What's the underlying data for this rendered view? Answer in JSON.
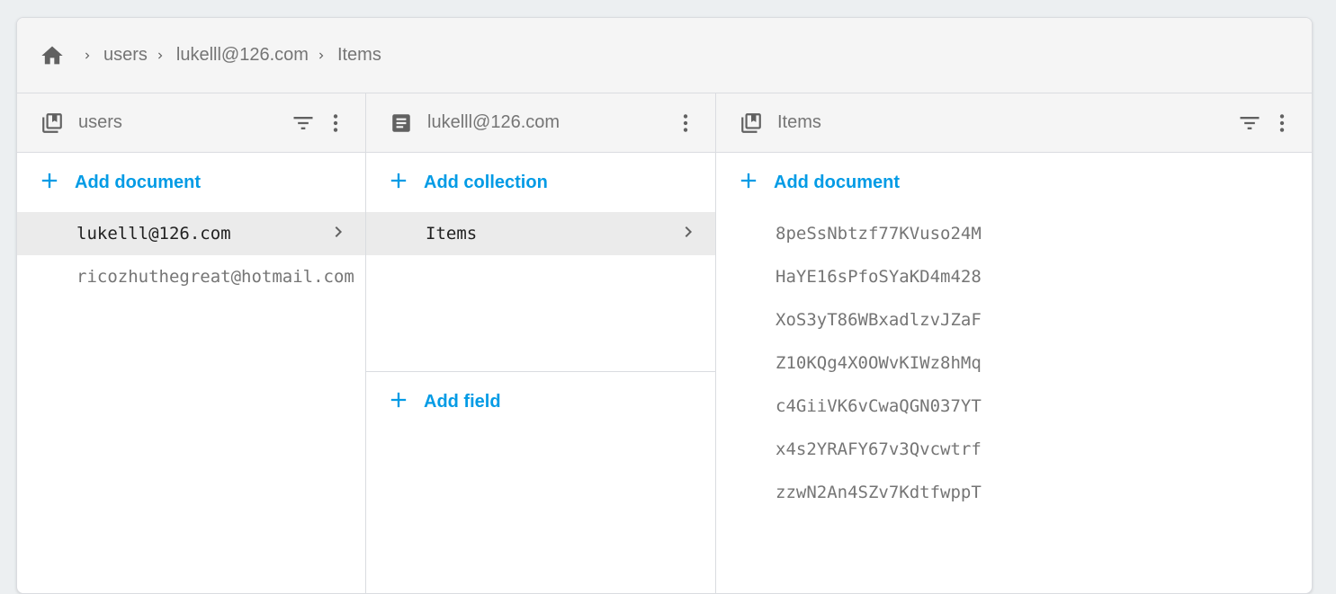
{
  "breadcrumb": {
    "items": [
      "users",
      "lukelll@126.com",
      "Items"
    ]
  },
  "colors": {
    "accent": "#039be5",
    "icon": "#616161",
    "selected_bg": "#ebebeb"
  },
  "panels": {
    "collection_users": {
      "title": "users",
      "add_label": "Add document",
      "documents": [
        "lukelll@126.com",
        "ricozhuthegreat@hotmail.com"
      ]
    },
    "document": {
      "title": "lukelll@126.com",
      "add_collection_label": "Add collection",
      "collections": [
        "Items"
      ],
      "add_field_label": "Add field"
    },
    "collection_items": {
      "title": "Items",
      "add_label": "Add document",
      "documents": [
        "8peSsNbtzf77KVuso24M",
        "HaYE16sPfoSYaKD4m428",
        "XoS3yT86WBxadlzvJZaF",
        "Z10KQg4X0OWvKIWz8hMq",
        "c4GiiVK6vCwaQGN037YT",
        "x4s2YRAFY67v3Qvcwtrf",
        "zzwN2An4SZv7KdtfwppT"
      ]
    }
  }
}
